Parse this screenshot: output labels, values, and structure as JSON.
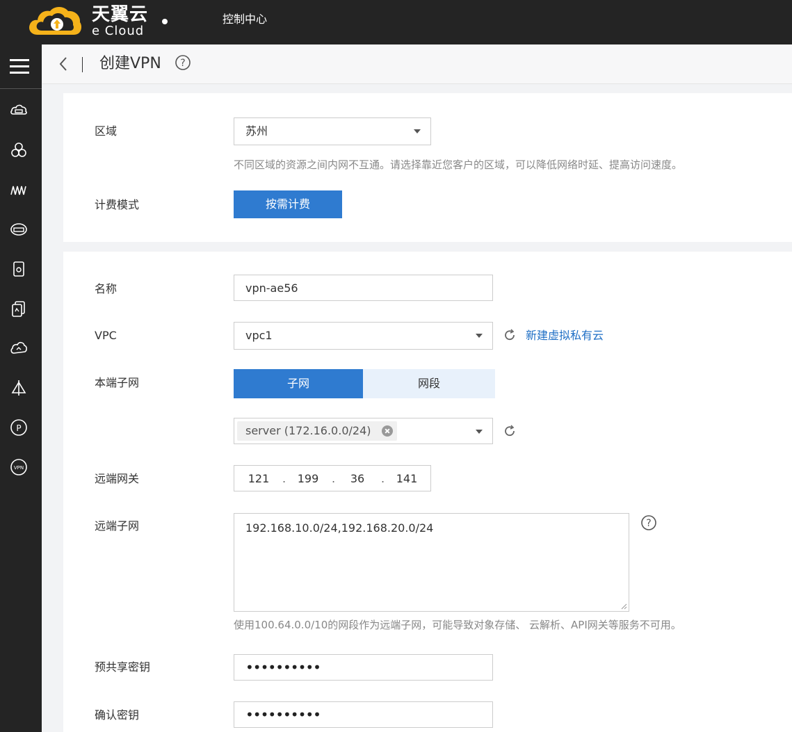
{
  "brand": {
    "name_cn": "天翼云",
    "name_en": "e Cloud"
  },
  "topnav": {
    "console": "控制中心"
  },
  "sidebar": {
    "items": [
      "cloud-host-icon",
      "cluster-icon",
      "container-icon",
      "disk-icon",
      "storage-icon",
      "backup-icon",
      "cloud-icon",
      "network-icon",
      "public-ip-icon",
      "vpn-icon"
    ]
  },
  "header": {
    "title": "创建VPN"
  },
  "region": {
    "label": "区域",
    "value": "苏州",
    "hint": "不同区域的资源之间内网不互通。请选择靠近您客户的区域，可以降低网络时延、提高访问速度。"
  },
  "billing": {
    "label": "计费模式",
    "button": "按需计费"
  },
  "form": {
    "name": {
      "label": "名称",
      "value": "vpn-ae56"
    },
    "vpc": {
      "label": "VPC",
      "value": "vpc1",
      "link": "新建虚拟私有云"
    },
    "local_subnet": {
      "label": "本端子网",
      "tab_subnet": "子网",
      "tab_segment": "网段",
      "selected": "server (172.16.0.0/24)"
    },
    "remote_gateway": {
      "label": "远端网关",
      "octets": [
        "121",
        "199",
        "36",
        "141"
      ],
      "dot": "."
    },
    "remote_subnet": {
      "label": "远端子网",
      "value": "192.168.10.0/24,192.168.20.0/24",
      "hint": "使用100.64.0.0/10的网段作为远端子网，可能导致对象存储、 云解析、API网关等服务不可用。"
    },
    "psk": {
      "label": "预共享密钥",
      "value": "••••••••••"
    },
    "confirm_key": {
      "label": "确认密钥",
      "value": "••••••••••"
    }
  },
  "colors": {
    "primary": "#2f7bd0",
    "link": "#1f6fc5",
    "dark": "#242424"
  }
}
